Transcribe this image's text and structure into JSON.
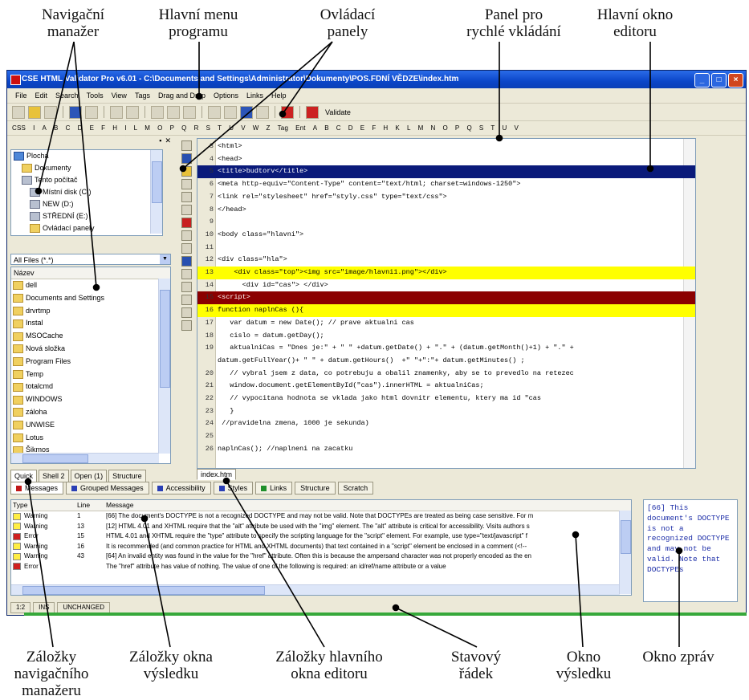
{
  "annotations": {
    "nav_manager": "Navigační\nmanažer",
    "main_menu": "Hlavní menu\nprogramu",
    "toolbars": "Ovládací\npanely",
    "quick_insert": "Panel pro\nrychlé vkládání",
    "main_window": "Hlavní okno\neditoru",
    "nav_tabs": "Záložky\nnavigačního\nmanažeru",
    "result_tabs": "Záložky okna\nvýsledku",
    "editor_tabs": "Záložky hlavního\nokna editoru",
    "status_bar": "Stavový\nřádek",
    "result_window": "Okno\nvýsledku",
    "error_window": "Okno zpráv"
  },
  "app": {
    "title": "CSE HTML Validator Pro v6.01 - C:\\Documents and Settings\\Administrator\\Dokumenty\\POS.FDNÍ VĚDZE\\index.htm",
    "menu": [
      "File",
      "Edit",
      "Search",
      "Tools",
      "View",
      "Tags",
      "Drag and Drop",
      "Options",
      "Links",
      "Help"
    ],
    "validate_label": "Validate",
    "charbar_left": [
      "CSS",
      "I",
      "A",
      "B",
      "C",
      "D",
      "E",
      "F",
      "H",
      "I",
      "L",
      "M",
      "O",
      "P",
      "Q",
      "R",
      "S",
      "T",
      "U",
      "V",
      "W",
      "Z"
    ],
    "charbar_tag": "Tag",
    "charbar_right": [
      "Ent",
      "A",
      "B",
      "C",
      "D",
      "E",
      "F",
      "H",
      "K",
      "L",
      "M",
      "N",
      "O",
      "P",
      "Q",
      "S",
      "T",
      "U",
      "V"
    ]
  },
  "tree": [
    {
      "label": "Plocha",
      "icon": "desk",
      "indent": 0
    },
    {
      "label": "Dokumenty",
      "icon": "folder",
      "indent": 1
    },
    {
      "label": "Tento počítač",
      "icon": "drive",
      "indent": 1
    },
    {
      "label": "Místní disk (C:)",
      "icon": "drive",
      "indent": 2
    },
    {
      "label": "NEW (D:)",
      "icon": "drive",
      "indent": 2
    },
    {
      "label": "STŘEDNÍ (E:)",
      "icon": "drive",
      "indent": 2
    },
    {
      "label": "Ovládací panely",
      "icon": "folder",
      "indent": 2
    }
  ],
  "file_filter": "All Files (*.*)",
  "file_header": "Název",
  "files": [
    "dell",
    "Documents and Settings",
    "drvrtmp",
    "Instal",
    "MSOCache",
    "Nová složka",
    "Program Files",
    "Temp",
    "totalcmd",
    "WINDOWS",
    "záloha",
    "UNWISE",
    "Lotus",
    "Šikmos"
  ],
  "nav_tabs": [
    "Quick",
    "Shell 2",
    "Open (1)",
    "Structure"
  ],
  "editor_tab": "index.htm",
  "code_lines": [
    {
      "n": "3",
      "t": "<html>",
      "hl": ""
    },
    {
      "n": "4",
      "t": "<head>",
      "hl": ""
    },
    {
      "n": "5",
      "t": "<title>budtorv</title>",
      "hl": "blue"
    },
    {
      "n": "6",
      "t": "<meta http-equiv=\"Content-Type\" content=\"text/html; charset=windows-1250\">",
      "hl": ""
    },
    {
      "n": "7",
      "t": "<link rel=\"stylesheet\" href=\"styly.css\" type=\"text/css\">",
      "hl": ""
    },
    {
      "n": "8",
      "t": "</head>",
      "hl": ""
    },
    {
      "n": "9",
      "t": "",
      "hl": ""
    },
    {
      "n": "10",
      "t": "<body class=\"hlavni\">",
      "hl": ""
    },
    {
      "n": "11",
      "t": "",
      "hl": ""
    },
    {
      "n": "12",
      "t": "<div class=\"hla\">",
      "hl": ""
    },
    {
      "n": "13",
      "t": "    <div class=\"top\"><img src=\"image/hlavni1.png\"></div>",
      "hl": "yellow"
    },
    {
      "n": "14",
      "t": "      <div id=\"cas\"> </div>",
      "hl": ""
    },
    {
      "n": "15",
      "t": "<script>",
      "hl": "red"
    },
    {
      "n": "16",
      "t": "function naplnCas (){",
      "hl": "yellow"
    },
    {
      "n": "17",
      "t": "   var datum = new Date(); // prave aktualni cas",
      "hl": ""
    },
    {
      "n": "18",
      "t": "   cislo = datum.getDay();",
      "hl": ""
    },
    {
      "n": "19",
      "t": "   aktualniCas = \"Dnes je:\" + \" \" +datum.getDate() + \".\" + (datum.getMonth()+1) + \".\" +",
      "hl": ""
    },
    {
      "n": "",
      "t": "datum.getFullYear()+ \" \" + datum.getHours()  +\" \"+\":\"+ datum.getMinutes() ;",
      "hl": ""
    },
    {
      "n": "20",
      "t": "   // vybral jsem z data, co potrebuju a obalil znamenky, aby se to prevedlo na retezec",
      "hl": ""
    },
    {
      "n": "21",
      "t": "   window.document.getElementById(\"cas\").innerHTML = aktualniCas;",
      "hl": ""
    },
    {
      "n": "22",
      "t": "   // vypocitana hodnota se vklada jako html dovnitr elementu, ktery ma id \"cas",
      "hl": ""
    },
    {
      "n": "23",
      "t": "   }",
      "hl": ""
    },
    {
      "n": "24",
      "t": " //pravidelna zmena, 1000 je sekunda)",
      "hl": ""
    },
    {
      "n": "25",
      "t": "",
      "hl": ""
    },
    {
      "n": "26",
      "t": "naplnCas(); //naplneni na zacatku",
      "hl": ""
    }
  ],
  "result_tabs": [
    {
      "label": "Messages",
      "dot": "red",
      "active": true
    },
    {
      "label": "Grouped Messages",
      "dot": "blue",
      "active": false
    },
    {
      "label": "Accessibility",
      "dot": "blue",
      "active": false
    },
    {
      "label": "Styles",
      "dot": "blue",
      "active": false
    },
    {
      "label": "Links",
      "dot": "green",
      "active": false
    },
    {
      "label": "Structure",
      "dot": "",
      "active": false
    },
    {
      "label": "Scratch",
      "dot": "",
      "active": false
    }
  ],
  "result_columns": [
    "Type",
    "Line",
    "Message"
  ],
  "results": [
    {
      "type": "Warning",
      "kind": "w",
      "line": "1",
      "msg": "[66] The document's DOCTYPE is not a recognized DOCTYPE and may not be valid. Note that DOCTYPEs are treated as being case sensitive. For m"
    },
    {
      "type": "Warning",
      "kind": "w",
      "line": "13",
      "msg": "[12] HTML 4.01 and XHTML require that the \"alt\" attribute be used with the \"img\" element. The \"alt\" attribute is critical for accessibility. Visits authors s"
    },
    {
      "type": "Error",
      "kind": "e",
      "line": "15",
      "msg": "HTML 4.01 and XHTML require the \"type\" attribute to specify the scripting language for the \"script\" element. For example, use type=\"text/javascript\" f"
    },
    {
      "type": "Warning",
      "kind": "w",
      "line": "16",
      "msg": "It is recommended (and common practice for HTML and XHTML documents) that text contained in a \"script\" element be enclosed in a comment (<!--"
    },
    {
      "type": "Warning",
      "kind": "w",
      "line": "43",
      "msg": "[64] An invalid entity was found in the value for the \"href\" attribute. Often this is because the ampersand character was not properly encoded as the en"
    },
    {
      "type": "Error",
      "kind": "e",
      "line": "",
      "msg": "The \"href\" attribute has value of nothing. The value of one of the following is required: an id/ref/name attribute or a value"
    }
  ],
  "error_text": "[66] This document's DOCTYPE is not a recognized DOCTYPE and may not be valid. Note that DOCTYPEs",
  "status": [
    "1:2",
    "INS",
    "UNCHANGED"
  ]
}
